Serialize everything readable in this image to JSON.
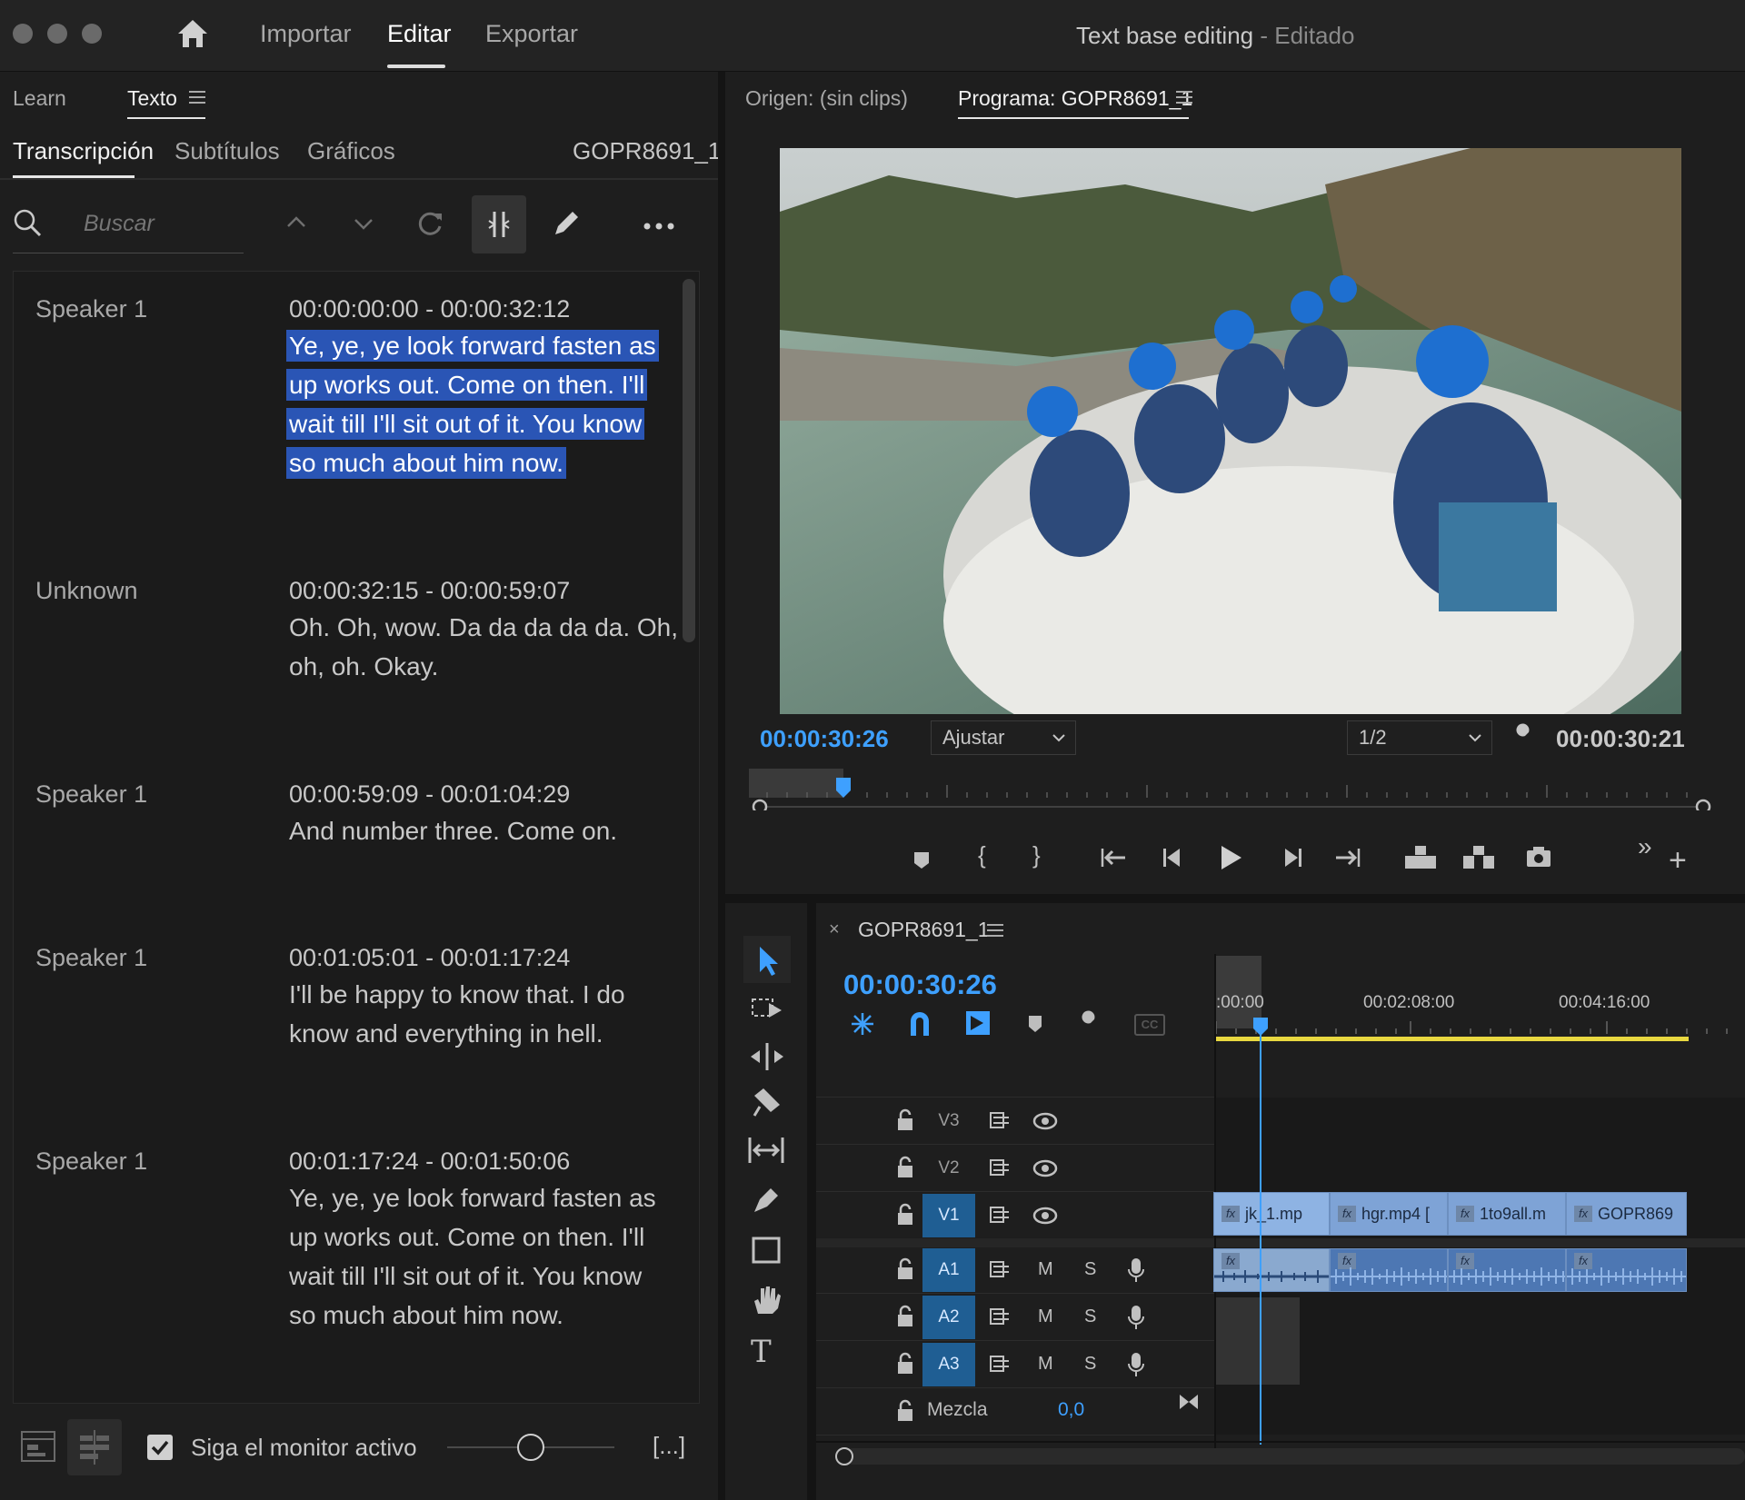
{
  "titlebar": {
    "nav": [
      "Importar",
      "Editar",
      "Exportar"
    ],
    "project_title": "Text base editing",
    "project_status": "- Editado"
  },
  "left_panel": {
    "top_tabs": [
      "Learn",
      "Texto"
    ],
    "sub_tabs": [
      "Transcripción",
      "Subtítulos",
      "Gráficos"
    ],
    "clip_name": "GOPR8691_1",
    "search_placeholder": "Buscar",
    "transcript": [
      {
        "speaker": "Speaker 1",
        "time": "00:00:00:00 - 00:00:32:12",
        "text": "Ye, ye, ye look forward fasten as up works out. Come on then. I'll wait till I'll sit out of it. You know so much about him now.",
        "highlighted": true
      },
      {
        "speaker": "Unknown",
        "time": "00:00:32:15 - 00:00:59:07",
        "text": "Oh. Oh, wow. Da da da da da. Oh, oh, oh. Okay.",
        "highlighted": false
      },
      {
        "speaker": "Speaker 1",
        "time": "00:00:59:09 - 00:01:04:29",
        "text": "And number three. Come on.",
        "highlighted": false
      },
      {
        "speaker": "Speaker 1",
        "time": "00:01:05:01 - 00:01:17:24",
        "text": "I'll be happy to know that. I do know and everything in hell.",
        "highlighted": false
      },
      {
        "speaker": "Speaker 1",
        "time": "00:01:17:24 - 00:01:50:06",
        "text": "Ye, ye, ye look forward fasten as up works out. Come on then. I'll wait till I'll sit out of it. You know so much about him now.",
        "highlighted": false
      }
    ],
    "follow_monitor_label": "Siga el monitor activo",
    "follow_monitor_checked": true,
    "ellipsis_button": "[...]"
  },
  "monitor": {
    "source_tab": "Origen: (sin clips)",
    "program_tab": "Programa: GOPR8691_1",
    "current_tc": "00:00:30:26",
    "fit_label": "Ajustar",
    "resolution": "1/2",
    "duration_tc": "00:00:30:21"
  },
  "timeline": {
    "sequence_name": "GOPR8691_1",
    "current_tc": "00:00:30:26",
    "ruler_labels": [
      ":00:00",
      "00:02:08:00",
      "00:04:16:00"
    ],
    "video_tracks": [
      "V3",
      "V2",
      "V1"
    ],
    "audio_tracks": [
      "A1",
      "A2",
      "A3"
    ],
    "mute_label": "M",
    "solo_label": "S",
    "mix_label": "Mezcla",
    "mix_value": "0,0",
    "video_clips": [
      "jk_1.mp",
      "hgr.mp4 [",
      "1to9all.m",
      "GOPR869"
    ],
    "fx_label": "fx"
  },
  "colors": {
    "accent_blue": "#3ea0ff",
    "selection": "#2a55b5",
    "work_area": "#e8d840"
  }
}
